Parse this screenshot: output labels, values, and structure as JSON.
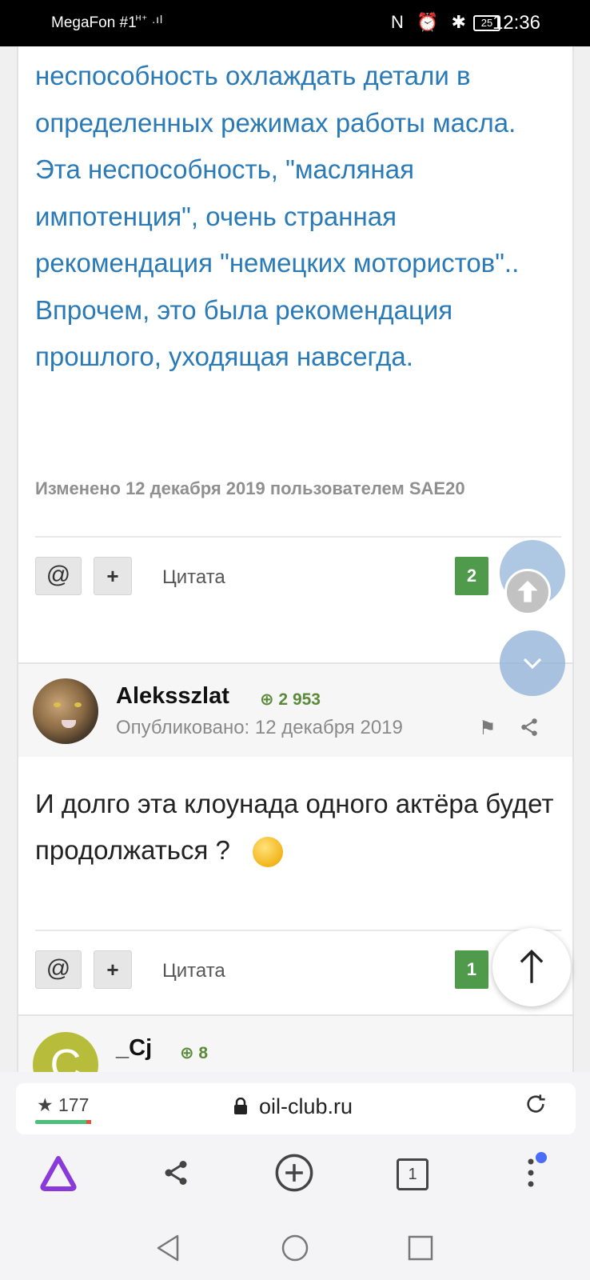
{
  "status_bar": {
    "carrier": "MegaFon #1",
    "signal": "ᴴ⁺ .ıl",
    "icons": "N ⏰ ✱",
    "battery": "25",
    "time": "12:36"
  },
  "post1": {
    "quote_text": "неспособность охлаждать детали в определенных режимах работы масла. Эта неспособность, \"масляная импотенция\", очень странная рекомендация \"немецких мотористов\".. Впрочем, это была рекомендация прошлого, уходящая навсегда.",
    "edited": "Изменено 12 декабря 2019 пользователем SAE20",
    "mention_label": "@",
    "plus_label": "+",
    "quote_label": "Цитата",
    "reaction_count": "2"
  },
  "post2": {
    "username": "Aleksszlat",
    "reputation": "⊕ 2 953",
    "posted": "Опубликовано: 12 декабря 2019",
    "body": "И долго эта клоунада одного актёра будет продолжаться ?",
    "mention_label": "@",
    "plus_label": "+",
    "quote_label": "Цитата",
    "reaction_count": "1"
  },
  "post3": {
    "avatar_letter": "C",
    "username": "_Cj",
    "reputation": "⊕ 8"
  },
  "browser": {
    "rating": "★ 177",
    "url": "oil-club.ru",
    "tab_count": "1"
  },
  "icons": {
    "flag": "flag-icon",
    "share": "share-icon",
    "scroll_up": "arrow-up-icon",
    "scroll_down": "chevron-down-icon",
    "to_top": "arrow-up-icon",
    "lock": "lock-icon",
    "reload": "reload-icon"
  },
  "colors": {
    "quote_blue": "#2a7ab8",
    "reaction_green": "#4f9a4b",
    "reputation_green": "#5b8a3a",
    "alice_purple": "#8a3ad9"
  }
}
